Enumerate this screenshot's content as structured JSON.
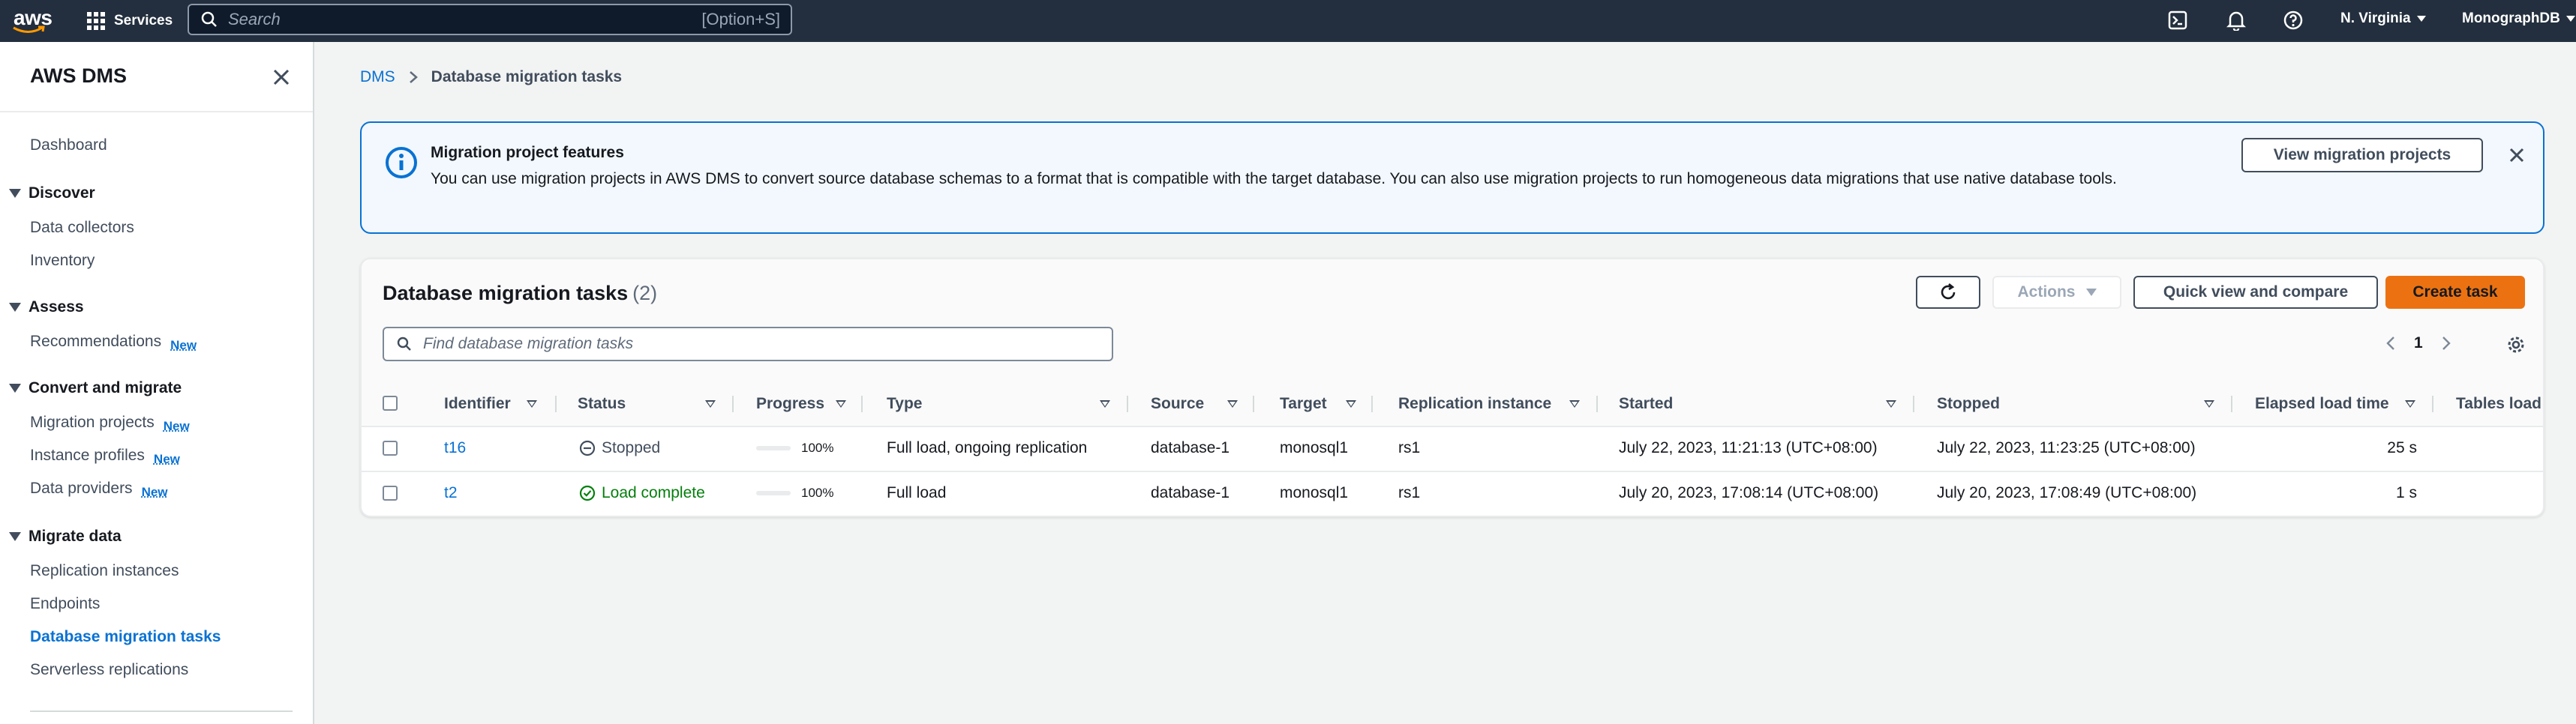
{
  "topnav": {
    "logo_text": "aws",
    "services_label": "Services",
    "search_placeholder": "Search",
    "search_shortcut": "[Option+S]",
    "region": "N. Virginia",
    "account": "MonographDB"
  },
  "sidebar": {
    "title": "AWS DMS",
    "dashboard": "Dashboard",
    "sections": {
      "discover": "Discover",
      "assess": "Assess",
      "convert": "Convert and migrate",
      "migrate": "Migrate data"
    },
    "items": {
      "data_collectors": "Data collectors",
      "inventory": "Inventory",
      "recommendations": "Recommendations",
      "migration_projects": "Migration projects",
      "instance_profiles": "Instance profiles",
      "data_providers": "Data providers",
      "replication_instances": "Replication instances",
      "endpoints": "Endpoints",
      "database_migration_tasks": "Database migration tasks",
      "serverless_replications": "Serverless replications"
    },
    "new_badge": "New"
  },
  "breadcrumb": {
    "root": "DMS",
    "current": "Database migration tasks"
  },
  "banner": {
    "title": "Migration project features",
    "text": "You can use migration projects in AWS DMS to convert source database schemas to a format that is compatible with the target database. You can also use migration projects to run homogeneous data migrations that use native database tools.",
    "button": "View migration projects"
  },
  "panel": {
    "title": "Database migration tasks",
    "count": "(2)",
    "actions_label": "Actions",
    "quick_view_label": "Quick view and compare",
    "create_label": "Create task",
    "search_placeholder": "Find database migration tasks",
    "page_number": "1"
  },
  "table": {
    "columns": {
      "identifier": "Identifier",
      "status": "Status",
      "progress": "Progress",
      "type": "Type",
      "source": "Source",
      "target": "Target",
      "replication_instance": "Replication instance",
      "started": "Started",
      "stopped": "Stopped",
      "elapsed": "Elapsed load time",
      "tables_loaded": "Tables load"
    },
    "rows": [
      {
        "identifier": "t16",
        "status": "Stopped",
        "progress": "100%",
        "progress_fraction": 1.0,
        "type": "Full load, ongoing replication",
        "source": "database-1",
        "target": "monosql1",
        "replication_instance": "rs1",
        "started": "July 22, 2023, 11:21:13 (UTC+08:00)",
        "stopped": "July 22, 2023, 11:23:25 (UTC+08:00)",
        "elapsed": "25 s"
      },
      {
        "identifier": "t2",
        "status": "Load complete",
        "progress": "100%",
        "progress_fraction": 1.0,
        "type": "Full load",
        "source": "database-1",
        "target": "monosql1",
        "replication_instance": "rs1",
        "started": "July 20, 2023, 17:08:14 (UTC+08:00)",
        "stopped": "July 20, 2023, 17:08:49 (UTC+08:00)",
        "elapsed": "1 s"
      }
    ]
  },
  "colors": {
    "nav_bg": "#232f3e",
    "link": "#0972d3",
    "primary_button": "#ec7211",
    "success": "#037f0c"
  }
}
